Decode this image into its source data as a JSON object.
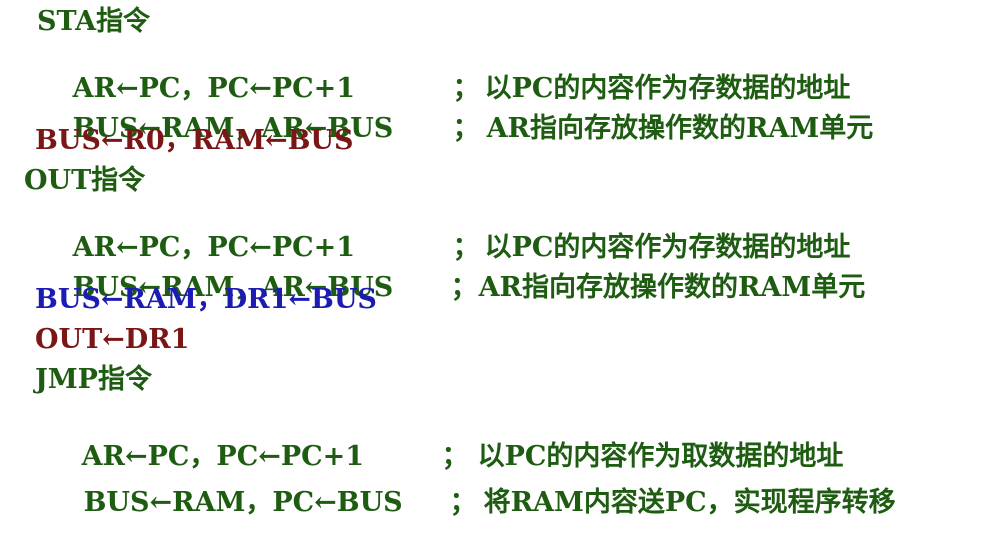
{
  "colors": {
    "green": "#1e5c12",
    "dark_red": "#7a1616",
    "blue": "#1c1cb3",
    "background": "#ffffff"
  },
  "sections": {
    "sta": {
      "title": "STA指令",
      "line1_code": "AR←PC，PC←PC+1",
      "line1_sep": "；",
      "line1_comment": "以PC的内容作为存数据的地址",
      "line2_code": "BUS←RAM，AR←BUS",
      "line2_sep": "；",
      "line2_comment": "AR指向存放操作数的RAM单元",
      "line3_code": "BUS←R0，RAM←BUS"
    },
    "out": {
      "title": "OUT指令",
      "line1_code": "AR←PC，PC←PC+1",
      "line1_sep": "；",
      "line1_comment": "以PC的内容作为存数据的地址",
      "line2_code": "BUS←RAM，AR←BUS",
      "line2_sep": "；",
      "line2_comment": "AR指向存放操作数的RAM单元",
      "line3_code": "BUS←RAM，DR1←BUS",
      "line4_code": "OUT←DR1"
    },
    "jmp": {
      "title": "JMP指令",
      "line1_code": "AR←PC，PC←PC+1",
      "line1_sep": "；",
      "line1_comment": "以PC的内容作为取数据的地址",
      "line2_code": "BUS←RAM，PC←BUS",
      "line2_sep": "；",
      "line2_comment": "将RAM内容送PC，实现程序转移"
    }
  }
}
